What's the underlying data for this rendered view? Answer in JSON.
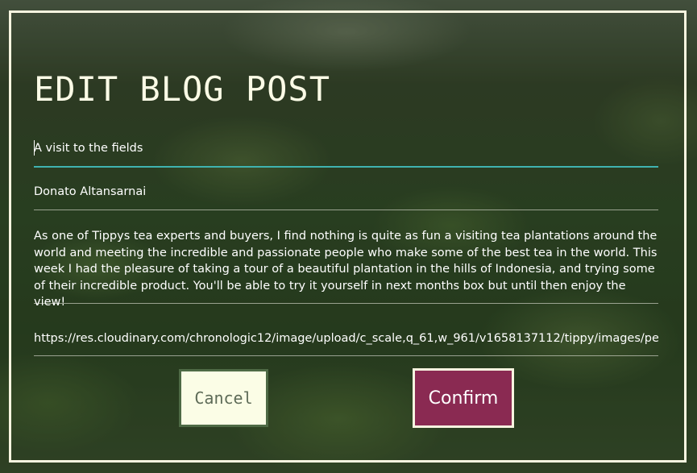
{
  "page": {
    "heading": "EDIT BLOG POST"
  },
  "form": {
    "title_value": "A visit to the fields",
    "author_value": "Donato Altansarnai",
    "body_value": "As one of Tippys tea experts and buyers, I find nothing is quite as fun a visiting tea plantations around the world and meeting the incredible and passionate people who make some of the best tea in the world.  This week I had the pleasure of taking a tour of a beautiful plantation in the hills of Indonesia, and trying some of their incredible product. You'll be able to try it yourself in next months box but until then enjoy the view!",
    "image_url_value": "https://res.cloudinary.com/chronologic12/image/upload/c_scale,q_61,w_961/v1658137112/tippy/images/pexe"
  },
  "actions": {
    "cancel_label": "Cancel",
    "confirm_label": "Confirm"
  },
  "colors": {
    "frame": "#f8f5e0",
    "active_underline": "#3fb3b0",
    "cancel_bg": "#fbfde6",
    "confirm_bg": "#8a2a52"
  }
}
